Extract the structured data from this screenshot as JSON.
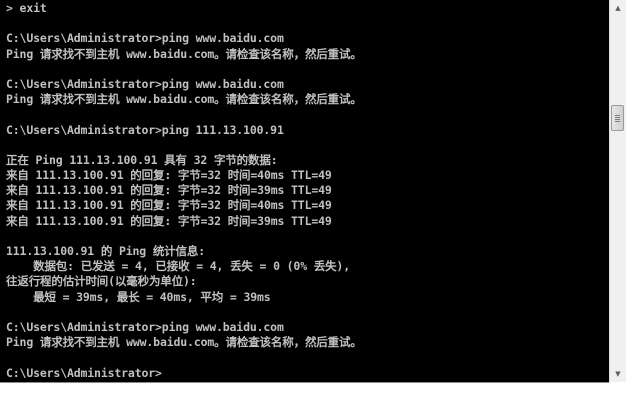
{
  "console": {
    "lines": [
      "> exit",
      "",
      "C:\\Users\\Administrator>ping www.baidu.com",
      "Ping 请求找不到主机 www.baidu.com。请检查该名称，然后重试。",
      "",
      "C:\\Users\\Administrator>ping www.baidu.com",
      "Ping 请求找不到主机 www.baidu.com。请检查该名称，然后重试。",
      "",
      "C:\\Users\\Administrator>ping 111.13.100.91",
      "",
      "正在 Ping 111.13.100.91 具有 32 字节的数据:",
      "来自 111.13.100.91 的回复: 字节=32 时间=40ms TTL=49",
      "来自 111.13.100.91 的回复: 字节=32 时间=39ms TTL=49",
      "来自 111.13.100.91 的回复: 字节=32 时间=40ms TTL=49",
      "来自 111.13.100.91 的回复: 字节=32 时间=39ms TTL=49",
      "",
      "111.13.100.91 的 Ping 统计信息:",
      "    数据包: 已发送 = 4, 已接收 = 4, 丢失 = 0 (0% 丢失),",
      "往返行程的估计时间(以毫秒为单位):",
      "    最短 = 39ms, 最长 = 40ms, 平均 = 39ms",
      "",
      "C:\\Users\\Administrator>ping www.baidu.com",
      "Ping 请求找不到主机 www.baidu.com。请检查该名称，然后重试。",
      "",
      "C:\\Users\\Administrator>"
    ]
  },
  "scrollbar": {
    "up_icon": "scroll-up-arrow",
    "down_icon": "scroll-down-arrow",
    "up_glyph": "▲",
    "down_glyph": "▼"
  },
  "colors": {
    "console_background": "#000000",
    "console_text": "#c0c0c0"
  }
}
